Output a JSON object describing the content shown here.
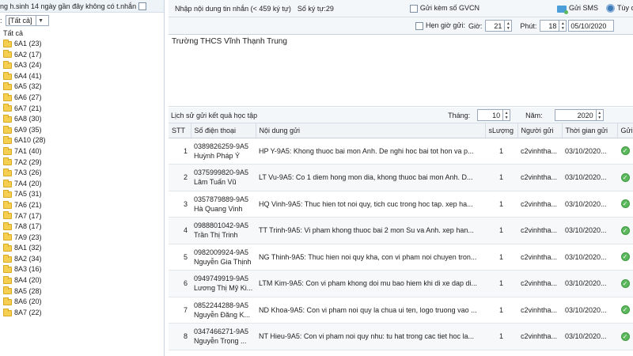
{
  "left": {
    "header_text": "ng h.sinh 14 ngày gần đây không có t.nhắn",
    "filter_prefix": ":",
    "filter_value": "[Tất cả]",
    "tree_root": "Tất cả",
    "classes": [
      "6A1 (23)",
      "6A2 (17)",
      "6A3 (24)",
      "6A4 (41)",
      "6A5 (32)",
      "6A6 (27)",
      "6A7 (21)",
      "6A8 (30)",
      "6A9 (35)",
      "6A10 (28)",
      "7A1 (40)",
      "7A2 (29)",
      "7A3 (26)",
      "7A4 (20)",
      "7A5 (31)",
      "7A6 (21)",
      "7A7 (17)",
      "7A8 (17)",
      "7A9 (23)",
      "8A1 (32)",
      "8A2 (34)",
      "8A3 (16)",
      "8A4 (20)",
      "8A5 (28)",
      "8A6 (20)",
      "8A7 (22)"
    ],
    "folder_color": "#f5cf52"
  },
  "toolbar": {
    "compose_label": "Nhập nội dung tin nhắn (< 459 ký tự)",
    "char_count": "Số ký tự:29",
    "attach_gvcn_label": "Gửi kèm số GVCN",
    "send_sms_label": "Gửi SMS",
    "options_label": "Tùy chọn",
    "schedule_label": "Hẹn giờ gửi:",
    "hour_label": "Giờ:",
    "hour_value": "21",
    "minute_label": "Phút:",
    "minute_value": "18",
    "date_value": "05/10/2020"
  },
  "message_text": "Trường THCS Vĩnh Thạnh Trung",
  "history": {
    "title": "Lịch sử gửi kết quả học tập",
    "month_label": "Tháng:",
    "month_value": "10",
    "year_label": "Năm:",
    "year_value": "2020",
    "columns": [
      "STT",
      "Số điện thoại",
      "Nội dung gửi",
      "sLượng",
      "Người gửi",
      "Thời gian gửi",
      "Gửi"
    ],
    "rows": [
      {
        "stt": "1",
        "phone": "0389826259-9A5",
        "name": "Huỳnh Pháp Ý",
        "content": "HP Y-9A5: Khong thuoc bai mon Anh. De nghi hoc bai tot hon va p...",
        "qty": "1",
        "sender": "c2vinhtha...",
        "time": "03/10/2020..."
      },
      {
        "stt": "2",
        "phone": "0375999820-9A5",
        "name": "Lâm Tuấn Vũ",
        "content": "LT Vu-9A5: Co 1 diem hong mon dia, khong thuoc bai mon Anh. D...",
        "qty": "1",
        "sender": "c2vinhtha...",
        "time": "03/10/2020..."
      },
      {
        "stt": "3",
        "phone": "0357879889-9A5",
        "name": "Hà Quang Vinh",
        "content": "HQ Vinh-9A5: Thuc hien tot noi quy, tich cuc trong hoc tap. xep ha...",
        "qty": "1",
        "sender": "c2vinhtha...",
        "time": "03/10/2020..."
      },
      {
        "stt": "4",
        "phone": "0988801042-9A5",
        "name": "Trần Thị Trinh",
        "content": "TT Trinh-9A5: Vi pham khong thuoc bai 2 mon Su va Anh. xep han...",
        "qty": "1",
        "sender": "c2vinhtha...",
        "time": "03/10/2020..."
      },
      {
        "stt": "5",
        "phone": "0982009924-9A5",
        "name": "Nguyễn Gia Thịnh",
        "content": "NG Thinh-9A5: Thuc hien noi quy kha, con vi pham noi chuyen tron...",
        "qty": "1",
        "sender": "c2vinhtha...",
        "time": "03/10/2020..."
      },
      {
        "stt": "6",
        "phone": "0949749919-9A5",
        "name": "Lương Thị Mỹ Ki...",
        "content": "LTM Kim-9A5: Con vi pham khong doi mu bao hiem khi di xe dap di...",
        "qty": "1",
        "sender": "c2vinhtha...",
        "time": "03/10/2020..."
      },
      {
        "stt": "7",
        "phone": "0852244288-9A5",
        "name": "Nguyễn Đăng K...",
        "content": "ND Khoa-9A5: Con vi pham noi quy la chua ui ten, logo truong vao ...",
        "qty": "1",
        "sender": "c2vinhtha...",
        "time": "03/10/2020..."
      },
      {
        "stt": "8",
        "phone": "0347466271-9A5",
        "name": "Nguyễn Trọng ...",
        "content": "NT Hieu-9A5: Con vi pham noi quy nhu: tu hat trong cac tiet hoc la...",
        "qty": "1",
        "sender": "c2vinhtha...",
        "time": "03/10/2020..."
      }
    ],
    "status_icon": "check-circle-icon",
    "status_color": "#5cb85c"
  }
}
